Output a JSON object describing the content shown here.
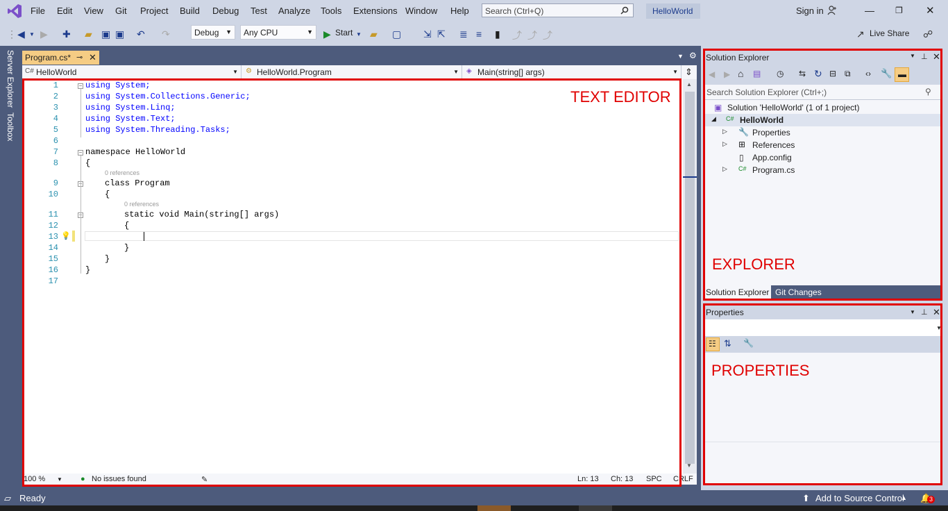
{
  "app": {
    "logo": "visual-studio-logo",
    "solution_name": "HelloWorld",
    "sign_in": "Sign in",
    "live_share": "Live Share"
  },
  "menu": {
    "items": [
      "File",
      "Edit",
      "View",
      "Git",
      "Project",
      "Build",
      "Debug",
      "Test",
      "Analyze",
      "Tools",
      "Extensions",
      "Window",
      "Help"
    ]
  },
  "search": {
    "placeholder": "Search (Ctrl+Q)"
  },
  "toolbar": {
    "config": "Debug",
    "platform": "Any CPU",
    "start_label": "Start"
  },
  "side_tabs": [
    "Server Explorer",
    "Toolbox"
  ],
  "editor": {
    "tab_label": "Program.cs*",
    "nav": {
      "project": "HelloWorld",
      "type": "HelloWorld.Program",
      "member": "Main(string[] args)"
    },
    "line_numbers": [
      "1",
      "2",
      "3",
      "4",
      "5",
      "6",
      "7",
      "8",
      "9",
      "10",
      "11",
      "12",
      "13",
      "14",
      "15",
      "16",
      "17"
    ],
    "lines": [
      "using System;",
      "using System.Collections.Generic;",
      "using System.Linq;",
      "using System.Text;",
      "using System.Threading.Tasks;",
      "",
      "namespace HelloWorld",
      "{",
      "class Program",
      "{",
      "static void Main(string[] args)",
      "{",
      "",
      "}",
      "}",
      "}",
      ""
    ],
    "codelens": "0 references",
    "status": {
      "zoom": "100 %",
      "issues": "No issues found",
      "ln": "Ln: 13",
      "ch": "Ch: 13",
      "spc": "SPC",
      "crlf": "CRLF"
    }
  },
  "solution_explorer": {
    "title": "Solution Explorer",
    "search_placeholder": "Search Solution Explorer (Ctrl+;)",
    "tree": {
      "solution": "Solution 'HelloWorld' (1 of 1 project)",
      "project": "HelloWorld",
      "items": [
        "Properties",
        "References",
        "App.config",
        "Program.cs"
      ]
    },
    "tabs": [
      "Solution Explorer",
      "Git Changes"
    ]
  },
  "properties": {
    "title": "Properties"
  },
  "annotations": {
    "editor": "TEXT EDITOR",
    "explorer": "EXPLORER",
    "properties": "PROPERTIES"
  },
  "statusbar": {
    "ready": "Ready",
    "source_control": "Add to Source Control",
    "notifications": "3"
  },
  "colors": {
    "accent": "#1b3a8c",
    "annotation": "#e00000",
    "tab_active": "#f5cc84"
  }
}
